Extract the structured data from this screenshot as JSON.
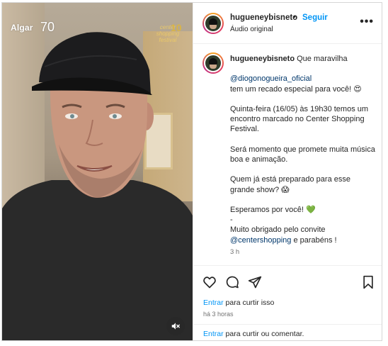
{
  "video": {
    "brand_name": "Algar",
    "brand_number": "70",
    "festival_line1": "center",
    "festival_line2": "shopping",
    "festival_line3": "festival",
    "festival_number": "10",
    "mute_icon": "speaker-muted-icon"
  },
  "header": {
    "username": "hugueneybisneto",
    "separator": "•",
    "follow_label": "Seguir",
    "audio_label": "Áudio original",
    "more_icon": "more-options-icon",
    "more_label": "•••"
  },
  "caption": {
    "username": "hugueneybisneto",
    "first_line": "Que maravilha",
    "mention1": "@diogonogueira_oficial",
    "line2": "tem um recado especial para você! 😍",
    "para2": "Quinta-feira (16/05) às 19h30 temos um encontro marcado no Center Shopping Festival.",
    "para3": "Será momento que promete muita música boa e animação.",
    "para4": "Quem já está preparado para esse grande show? 😱",
    "para5": "Esperamos por você! 💚",
    "dash": "-",
    "thanks": "Muito obrigado pelo convite",
    "mention2": "@centershopping",
    "thanks_end": "e parabéns !",
    "time": "3 h"
  },
  "actions": {
    "icons": [
      "heart-icon",
      "comment-icon",
      "share-icon",
      "bookmark-icon"
    ],
    "like_link": "Entrar",
    "like_text": "para curtir isso",
    "ago": "há 3 horas"
  },
  "comment": {
    "link": "Entrar",
    "text": "para curtir ou comentar."
  },
  "colors": {
    "link_blue": "#0095f6",
    "mention_blue": "#00376b",
    "muted_gray": "#737373"
  }
}
